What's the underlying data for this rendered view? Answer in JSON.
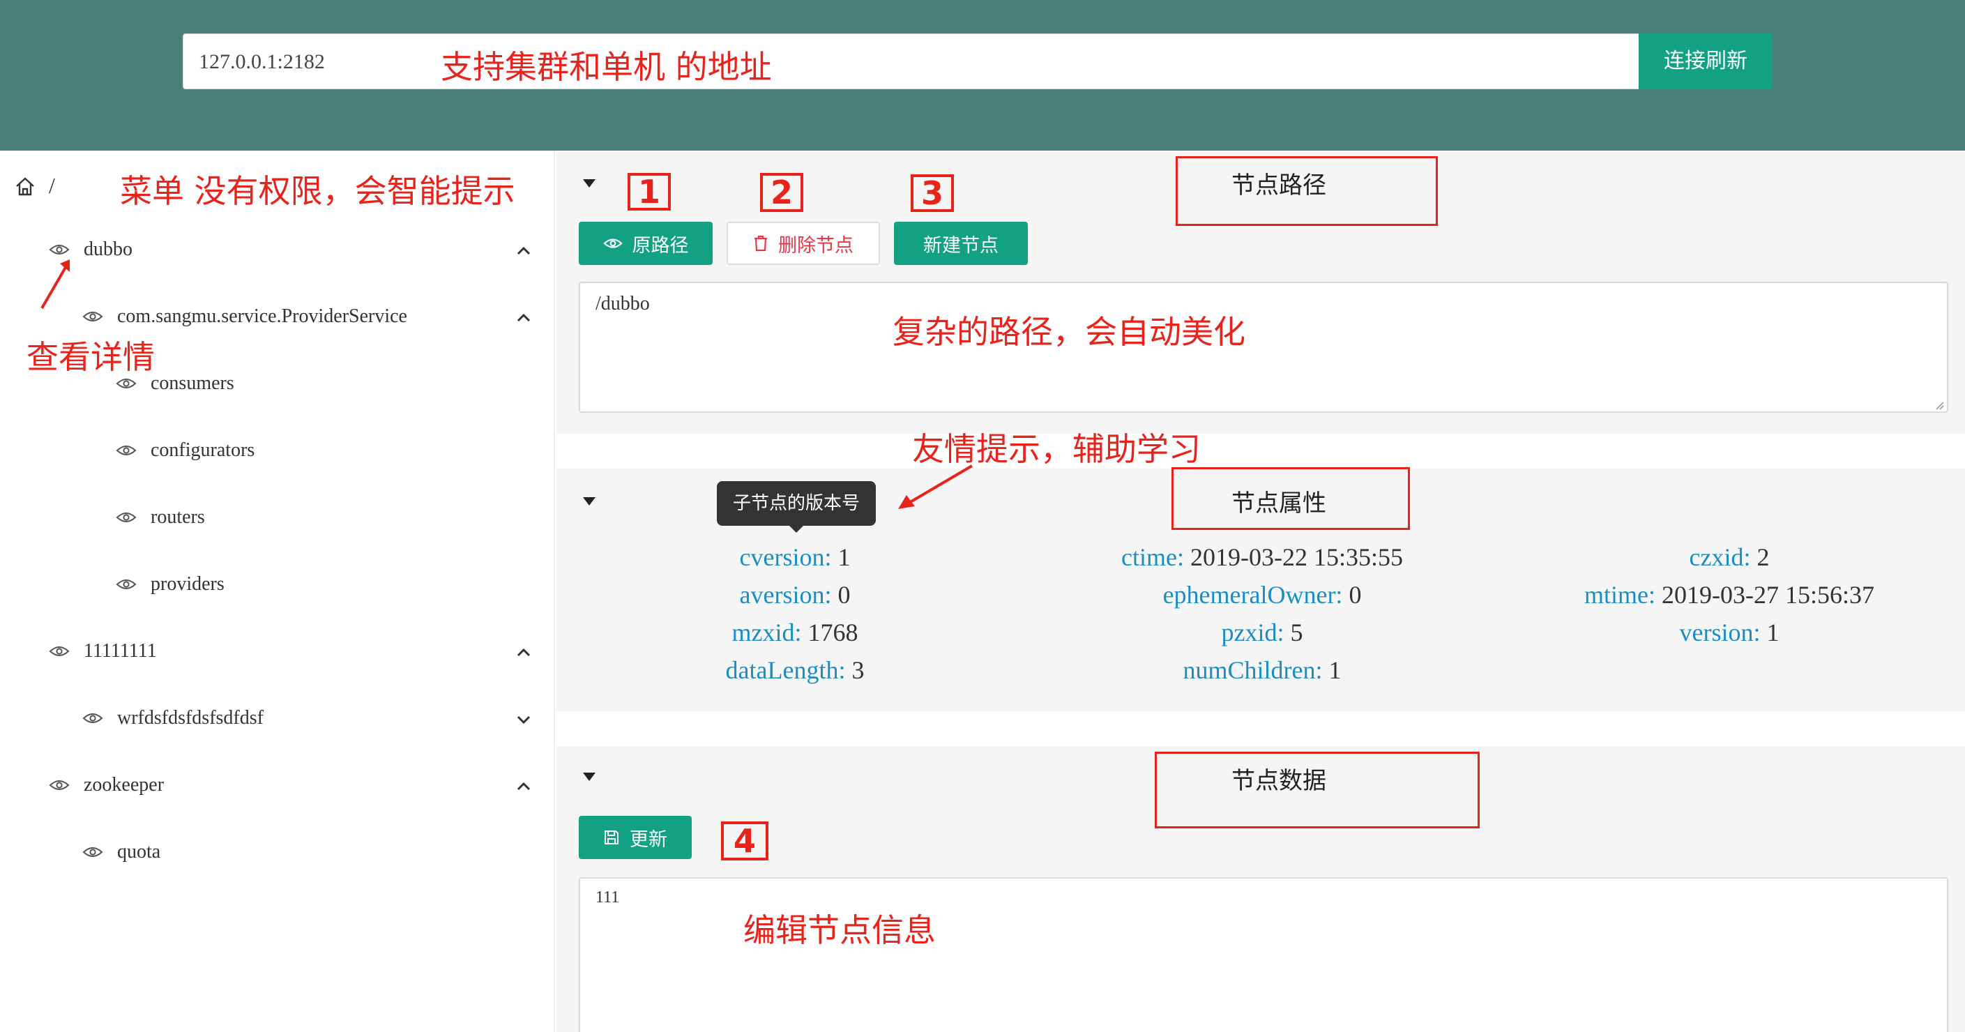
{
  "header": {
    "address_value": "127.0.0.1:2182",
    "connect_label": "连接刷新"
  },
  "sidebar": {
    "root_label": "/",
    "items": [
      {
        "label": "dubbo",
        "expanded": true
      },
      {
        "label": "com.sangmu.service.ProviderService",
        "expanded": true
      },
      {
        "label": "consumers"
      },
      {
        "label": "configurators"
      },
      {
        "label": "routers"
      },
      {
        "label": "providers"
      },
      {
        "label": "11111111",
        "expanded": true
      },
      {
        "label": "wrfdsfdsfdsfsdfdsf",
        "expanded": false
      },
      {
        "label": "zookeeper",
        "expanded": true
      },
      {
        "label": "quota"
      }
    ]
  },
  "path_panel": {
    "btn_original": "原路径",
    "btn_delete": "删除节点",
    "btn_new": "新建节点",
    "path_value": "/dubbo"
  },
  "props_panel": {
    "tooltip": "子节点的版本号",
    "props": [
      {
        "key": "cversion:",
        "value": "1"
      },
      {
        "key": "aversion:",
        "value": "0"
      },
      {
        "key": "mzxid:",
        "value": "1768"
      },
      {
        "key": "dataLength:",
        "value": "3"
      },
      {
        "key": "ctime:",
        "value": "2019-03-22 15:35:55"
      },
      {
        "key": "ephemeralOwner:",
        "value": "0"
      },
      {
        "key": "pzxid:",
        "value": "5"
      },
      {
        "key": "numChildren:",
        "value": "1"
      },
      {
        "key": "czxid:",
        "value": "2"
      },
      {
        "key": "mtime:",
        "value": "2019-03-27 15:56:37"
      },
      {
        "key": "version:",
        "value": "1"
      }
    ]
  },
  "data_panel": {
    "btn_update": "更新",
    "data_value": "111"
  },
  "annotations": {
    "address_note": "支持集群和单机 的地址",
    "menu_note": "菜单 没有权限，会智能提示",
    "detail_note": "查看详情",
    "path_box": "节点路径",
    "path_note": "复杂的路径，会自动美化",
    "tip_note": "友情提示，辅助学习",
    "props_box": "节点属性",
    "data_box": "节点数据",
    "edit_note": "编辑节点信息",
    "num1": "1",
    "num2": "2",
    "num3": "3",
    "num4": "4"
  },
  "colors": {
    "header_bg": "#4a8078",
    "primary": "#12a182",
    "key_blue": "#1a8ec4",
    "annotation_red": "#e8231b"
  }
}
